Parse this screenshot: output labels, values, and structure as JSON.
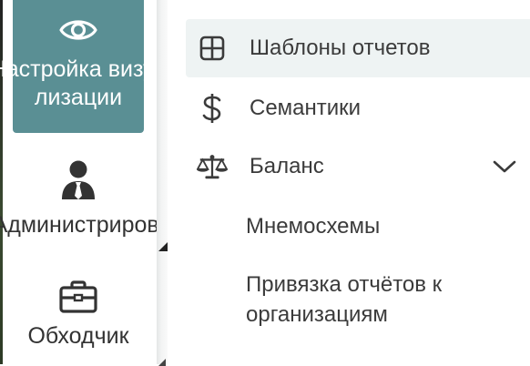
{
  "rail": {
    "items": [
      {
        "label": "Настройка визуализации",
        "icon": "eye-icon",
        "active": true
      },
      {
        "label": "Администрирование",
        "icon": "user-tie-icon",
        "active": false
      },
      {
        "label": "Обходчик",
        "icon": "briefcase-icon",
        "active": false
      }
    ]
  },
  "submenu": {
    "items": [
      {
        "label": "Шаблоны отчетов",
        "icon": "table-grid-icon",
        "selected": true
      },
      {
        "label": "Семантики",
        "icon": "dollar-icon",
        "selected": false
      },
      {
        "label": "Баланс",
        "icon": "scales-icon",
        "expandable": true,
        "expanded": false
      }
    ],
    "plain_items": [
      {
        "label": "Мнемосхемы"
      },
      {
        "label": "Привязка отчётов к организациям"
      }
    ]
  },
  "colors": {
    "accent": "#5a8f94",
    "selected_bg": "#eef3f3",
    "text": "#3b3b3b"
  }
}
